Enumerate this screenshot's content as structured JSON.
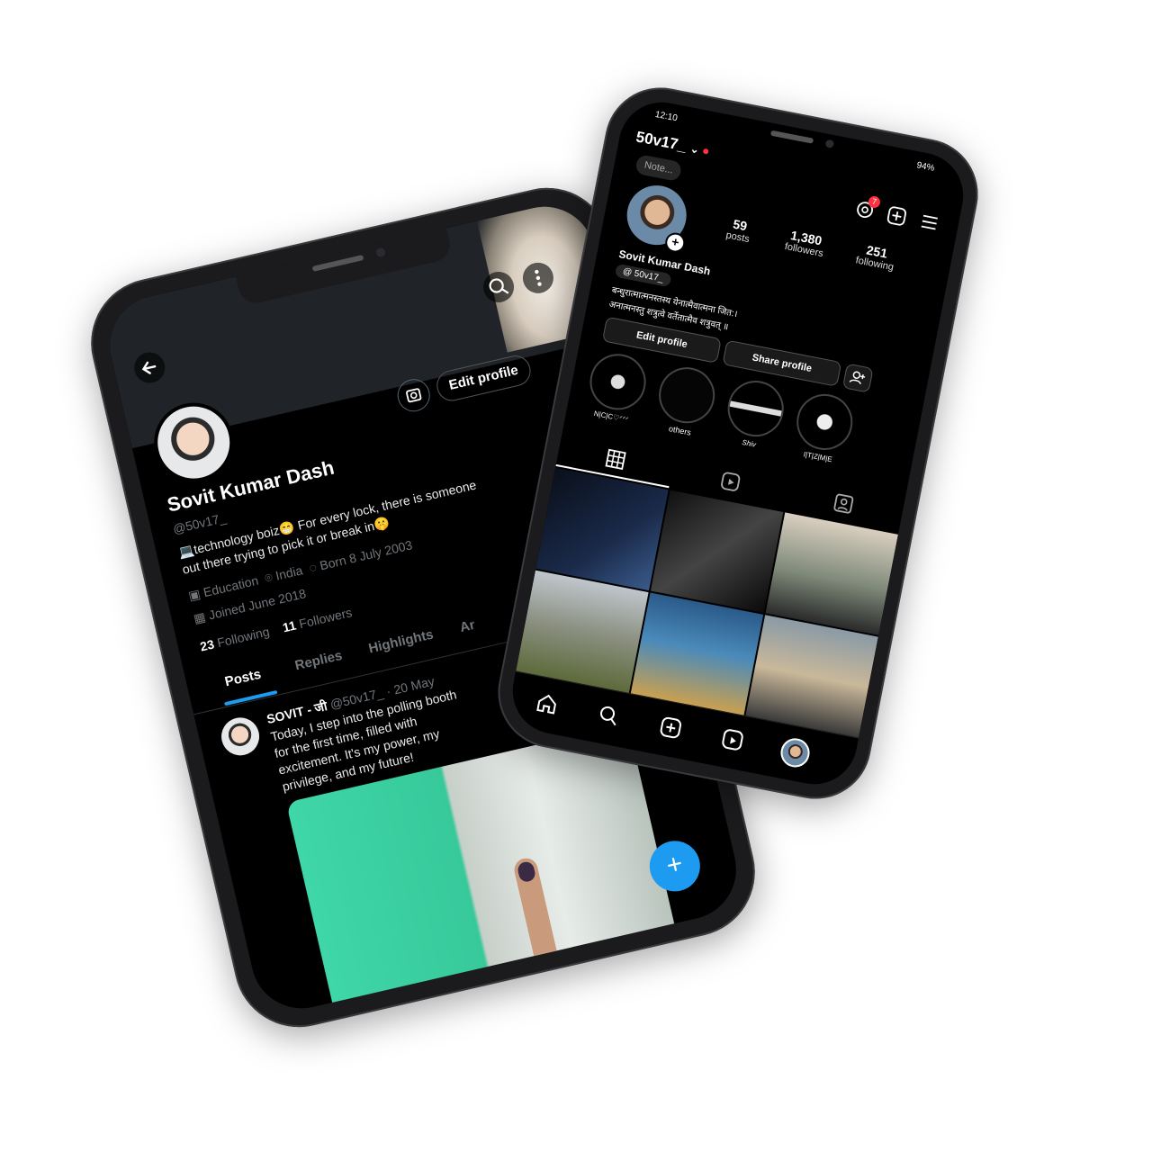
{
  "twitter": {
    "name": "Sovit Kumar Dash",
    "handle": "@50v17_",
    "edit_profile": "Edit profile",
    "bio": "💻technology boiz😁 For every lock, there is someone out there trying to pick it or break in🤫",
    "education": "Education",
    "location": "India",
    "born": "Born 8 July 2003",
    "joined": "Joined June 2018",
    "following_count": "23",
    "following_label": "Following",
    "followers_count": "11",
    "followers_label": "Followers",
    "tabs": [
      "Posts",
      "Replies",
      "Highlights",
      "Ar"
    ],
    "post": {
      "name": "SOVIT - जी",
      "meta": "@50v17_ · 20 May",
      "text": "Today, I step into the polling booth for the first time, filled with excitement. It's my power, my privilege, and my future!"
    },
    "fab": "+"
  },
  "instagram": {
    "time": "12:10",
    "battery": "94%",
    "username": "50v17_",
    "note": "Note...",
    "badge": "7",
    "posts_count": "59",
    "posts_label": "posts",
    "followers_count": "1,380",
    "followers_label": "followers",
    "following_count": "251",
    "following_label": "following",
    "full_name": "Sovit Kumar Dash",
    "threads_handle": "50v17_",
    "bio_line1": "बन्धुरात्मात्मनस्तस्य येनात्मैवात्मना जित:।",
    "bio_line2": "अनात्मनस्तु शत्रुत्वे वर्तेतात्मैव शत्रुवत् ॥",
    "edit_profile": "Edit profile",
    "share_profile": "Share profile",
    "highlights": [
      "N|C|C♡ᐟᐟᐟ",
      "others",
      "Shiv",
      "I|T|Z|M|E"
    ],
    "colors": {
      "notif": "#ff3040",
      "twitter_blue": "#1d9bf0"
    }
  }
}
